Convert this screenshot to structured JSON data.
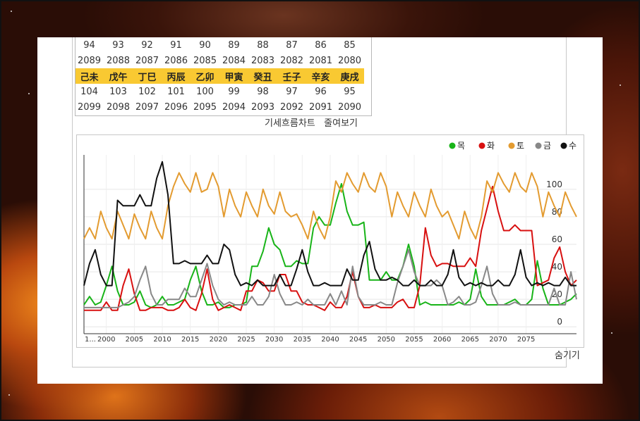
{
  "year_table": {
    "rows": [
      [
        "94",
        "93",
        "92",
        "91",
        "90",
        "89",
        "88",
        "87",
        "86",
        "85"
      ],
      [
        "2089",
        "2088",
        "2087",
        "2086",
        "2085",
        "2084",
        "2083",
        "2082",
        "2081",
        "2080"
      ],
      [
        "己未",
        "戊午",
        "丁巳",
        "丙辰",
        "乙卯",
        "甲寅",
        "癸丑",
        "壬子",
        "辛亥",
        "庚戌"
      ],
      [
        "104",
        "103",
        "102",
        "101",
        "100",
        "99",
        "98",
        "97",
        "96",
        "95"
      ],
      [
        "2099",
        "2098",
        "2097",
        "2096",
        "2095",
        "2094",
        "2093",
        "2092",
        "2091",
        "2090"
      ]
    ],
    "highlight_row": 2,
    "highlight_color": "#f9c932"
  },
  "links": {
    "flow_chart": "기세흐름차트",
    "collapse": "줄여보기",
    "hide": "숨기기"
  },
  "chart_data": {
    "type": "line",
    "x_start": 1996,
    "x_step": 1,
    "x_tick_labels": [
      "1...",
      "2000",
      "2005",
      "2010",
      "2015",
      "2020",
      "2025",
      "2030",
      "2035",
      "2040",
      "2045",
      "2050",
      "2055",
      "2060",
      "2065",
      "2070",
      "2075"
    ],
    "y_tick_labels": [
      "0",
      "20",
      "40",
      "60",
      "80",
      "100"
    ],
    "ylim": [
      -5,
      125
    ],
    "grid": true,
    "legend_position": "top-right",
    "series": [
      {
        "name": "목",
        "color": "#18b418",
        "values": [
          16,
          22,
          16,
          18,
          30,
          44,
          26,
          16,
          16,
          18,
          26,
          16,
          14,
          16,
          22,
          16,
          16,
          18,
          20,
          34,
          44,
          26,
          16,
          16,
          18,
          14,
          14,
          16,
          16,
          18,
          44,
          44,
          55,
          72,
          60,
          56,
          44,
          44,
          48,
          46,
          46,
          72,
          80,
          74,
          74,
          90,
          104,
          84,
          74,
          74,
          76,
          34,
          34,
          34,
          40,
          34,
          34,
          44,
          60,
          44,
          16,
          18,
          16,
          16,
          16,
          16,
          16,
          18,
          16,
          20,
          42,
          22,
          16,
          16,
          16,
          16,
          18,
          20,
          16,
          16,
          20,
          48,
          28,
          16,
          16,
          16,
          18,
          20,
          24
        ]
      },
      {
        "name": "화",
        "color": "#d81010",
        "values": [
          12,
          12,
          12,
          12,
          18,
          12,
          12,
          30,
          42,
          24,
          12,
          12,
          14,
          14,
          14,
          12,
          12,
          14,
          20,
          14,
          12,
          24,
          42,
          20,
          12,
          14,
          16,
          14,
          12,
          26,
          26,
          34,
          32,
          26,
          26,
          38,
          38,
          26,
          26,
          18,
          16,
          16,
          14,
          12,
          18,
          14,
          14,
          22,
          40,
          22,
          14,
          14,
          16,
          14,
          14,
          14,
          18,
          20,
          14,
          14,
          30,
          72,
          52,
          44,
          46,
          46,
          44,
          44,
          44,
          50,
          44,
          70,
          86,
          102,
          84,
          70,
          70,
          74,
          70,
          70,
          70,
          30,
          32,
          34,
          50,
          58,
          40,
          30,
          34
        ]
      },
      {
        "name": "토",
        "color": "#e39b30",
        "values": [
          64,
          72,
          64,
          84,
          72,
          64,
          84,
          74,
          64,
          82,
          72,
          64,
          84,
          72,
          64,
          88,
          102,
          112,
          104,
          98,
          112,
          98,
          100,
          112,
          102,
          80,
          100,
          88,
          80,
          98,
          88,
          80,
          100,
          88,
          82,
          98,
          84,
          80,
          82,
          74,
          64,
          84,
          72,
          64,
          80,
          106,
          98,
          112,
          104,
          98,
          112,
          102,
          98,
          112,
          102,
          80,
          98,
          88,
          80,
          98,
          88,
          80,
          100,
          88,
          80,
          84,
          74,
          64,
          84,
          72,
          64,
          80,
          106,
          98,
          112,
          104,
          98,
          112,
          102,
          98,
          112,
          102,
          80,
          98,
          88,
          80,
          98,
          88,
          80
        ]
      },
      {
        "name": "금",
        "color": "#888888",
        "values": [
          14,
          14,
          14,
          14,
          14,
          14,
          14,
          16,
          18,
          22,
          34,
          44,
          24,
          16,
          16,
          20,
          20,
          20,
          28,
          22,
          22,
          34,
          46,
          30,
          20,
          16,
          18,
          16,
          16,
          16,
          22,
          16,
          16,
          22,
          38,
          24,
          16,
          16,
          18,
          16,
          20,
          16,
          16,
          16,
          24,
          16,
          26,
          16,
          44,
          22,
          16,
          16,
          16,
          18,
          16,
          16,
          32,
          44,
          56,
          40,
          30,
          30,
          30,
          34,
          30,
          16,
          18,
          22,
          16,
          16,
          18,
          30,
          44,
          24,
          16,
          16,
          16,
          18,
          16,
          16,
          16,
          16,
          16,
          16,
          28,
          16,
          16,
          40,
          20
        ]
      },
      {
        "name": "수",
        "color": "#111111",
        "values": [
          30,
          46,
          56,
          38,
          30,
          30,
          92,
          88,
          88,
          88,
          96,
          88,
          88,
          108,
          120,
          96,
          46,
          46,
          48,
          46,
          46,
          46,
          52,
          46,
          46,
          60,
          56,
          38,
          30,
          32,
          30,
          34,
          30,
          30,
          30,
          38,
          30,
          30,
          42,
          56,
          40,
          30,
          30,
          32,
          30,
          30,
          30,
          42,
          34,
          34,
          52,
          62,
          42,
          34,
          34,
          36,
          34,
          30,
          30,
          34,
          30,
          30,
          34,
          30,
          30,
          38,
          56,
          36,
          30,
          32,
          30,
          32,
          30,
          30,
          34,
          30,
          30,
          38,
          56,
          36,
          30,
          32,
          30,
          32,
          30,
          30,
          36,
          30,
          30
        ]
      }
    ]
  }
}
